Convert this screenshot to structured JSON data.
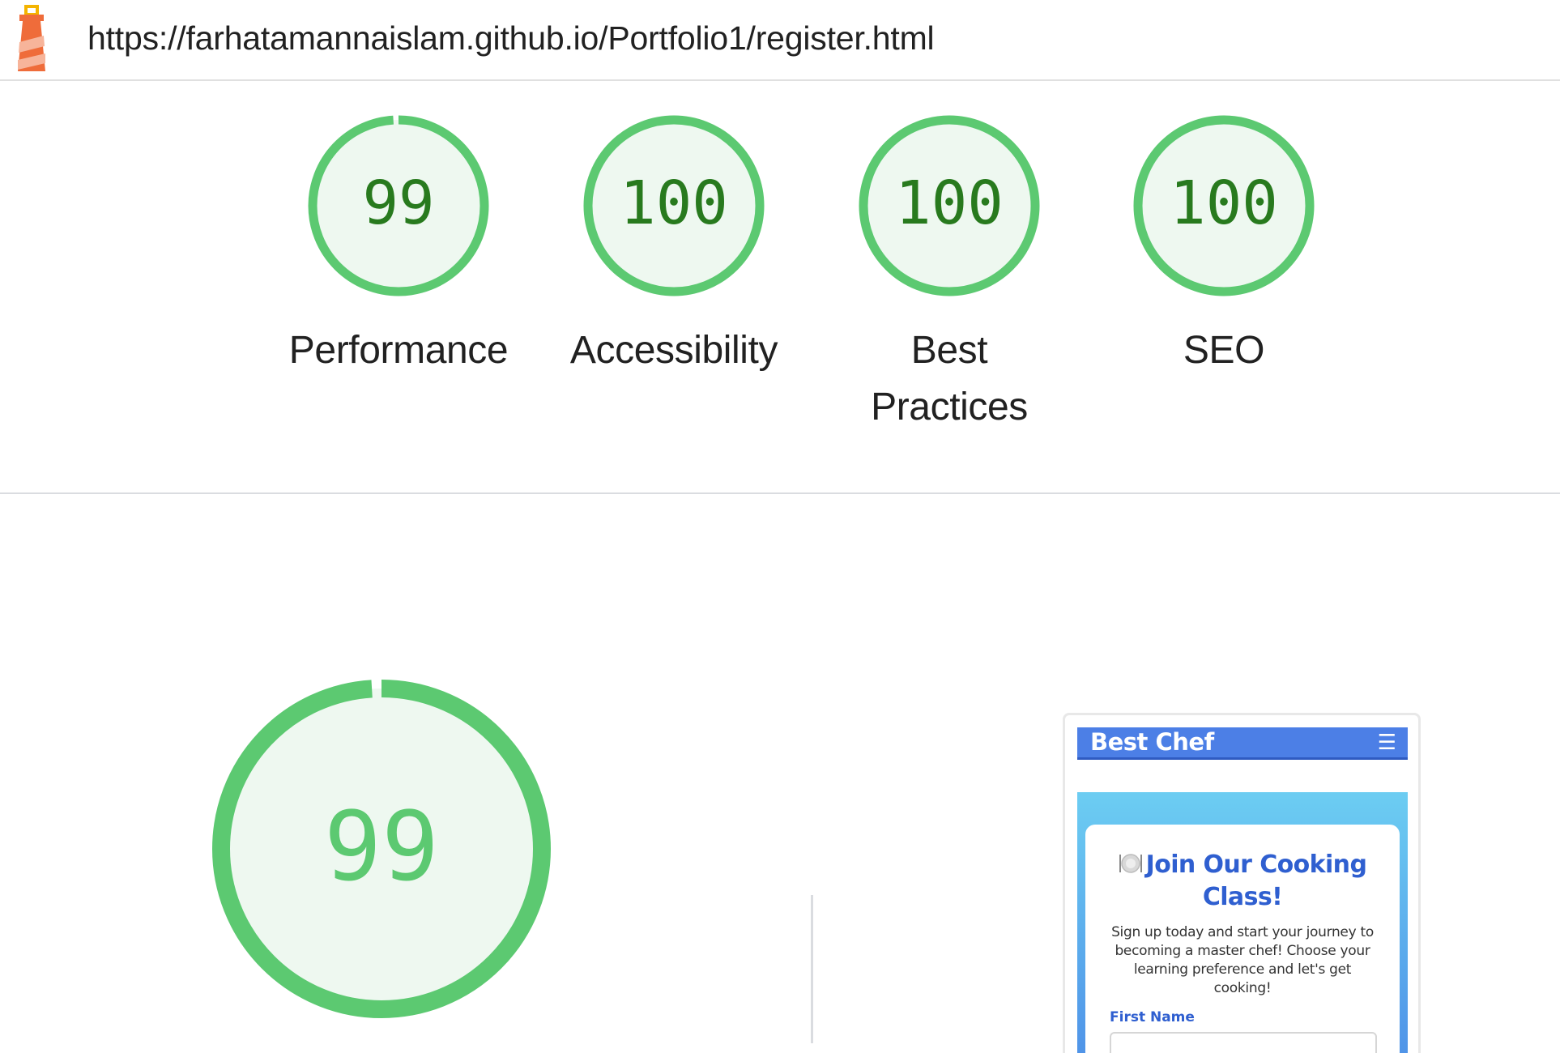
{
  "url": "https://farhatamannaislam.github.io/Portfolio1/register.html",
  "logo_icon": "lighthouse-icon",
  "colors": {
    "pass_ring": "#5cc971",
    "pass_fill": "#eef8f0",
    "pass_text": "#287a1e",
    "divider": "#dadce0"
  },
  "categories": [
    {
      "id": "performance",
      "score": "99",
      "label": "Performance",
      "fraction": 0.99
    },
    {
      "id": "accessibility",
      "score": "100",
      "label": "Accessibility",
      "fraction": 1.0
    },
    {
      "id": "best-practices",
      "score": "100",
      "label": "Best Practices",
      "fraction": 1.0
    },
    {
      "id": "seo",
      "score": "100",
      "label": "SEO",
      "fraction": 1.0
    }
  ],
  "main_gauge": {
    "score": "99",
    "fraction": 0.99
  },
  "screenshot": {
    "brand": "Best Chef",
    "menu_icon": "hamburger-menu-icon",
    "heading": "Join Our Cooking Class!",
    "heading_icon": "plate-icon",
    "description": "Sign up today and start your journey to becoming a master chef! Choose your learning preference and let's get cooking!",
    "field_label": "First Name"
  }
}
